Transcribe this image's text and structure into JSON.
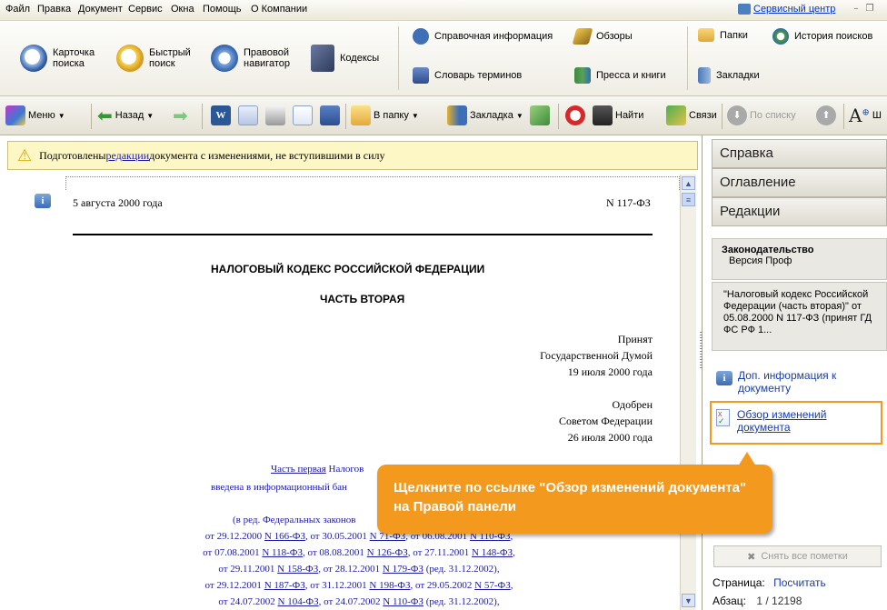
{
  "menu": {
    "items": [
      "Файл",
      "Правка",
      "Документ",
      "Сервис",
      "Окна",
      "Помощь",
      "О Компании"
    ],
    "service_center": "Сервисный центр",
    "win_min": "–",
    "win_restore": "❐"
  },
  "ribbon": {
    "card_search": "Карточка поиска",
    "quick_search": "Быстрый поиск",
    "legal_nav": "Правовой навигатор",
    "codes": "Кодексы",
    "reference": "Справочная информация",
    "reviews": "Обзоры",
    "glossary": "Словарь терминов",
    "press": "Пресса и книги",
    "folders": "Папки",
    "search_history": "История поисков",
    "bookmarks": "Закладки"
  },
  "toolbar": {
    "menu": "Меню",
    "back": "Назад",
    "to_folder": "В папку",
    "bookmark": "Закладка",
    "find": "Найти",
    "links": "Связи",
    "by_list": "По списку",
    "font_label": "Ш"
  },
  "notice": {
    "prefix": "Подготовлены ",
    "link": "редакции",
    "suffix": " документа с изменениями, не вступившими в силу"
  },
  "document": {
    "date": "5 августа 2000 года",
    "number": "N 117-ФЗ",
    "title": "НАЛОГОВЫЙ КОДЕКС РОССИЙСКОЙ ФЕДЕРАЦИИ",
    "part": "ЧАСТЬ ВТОРАЯ",
    "adopted": [
      "Принят",
      "Государственной Думой",
      "19 июля 2000 года"
    ],
    "approved": [
      "Одобрен",
      "Советом Федерации",
      "26 июля 2000 года"
    ],
    "intro_link": "Часть первая",
    "intro_text": " Налогов",
    "intro_line2": "введена в информационный бан",
    "editions_prefix": "(в ред. Федеральных законов ",
    "editions_line1": {
      "a": "от 29.12.2000 ",
      "l1": "N 166-ФЗ",
      "b": ", от 30.05.2001 ",
      "l2": "N 71-ФЗ",
      "c": ", от 06.08.2001 ",
      "l3": "N 110-ФЗ",
      "d": ","
    },
    "editions_line2": {
      "a": "от 07.08.2001 ",
      "l1": "N 118-ФЗ",
      "b": ", от 08.08.2001 ",
      "l2": "N 126-ФЗ",
      "c": ", от 27.11.2001 ",
      "l3": "N 148-ФЗ",
      "d": ","
    },
    "editions_line3": {
      "a": "от 29.11.2001 ",
      "l1": "N 158-ФЗ",
      "b": ", от 28.12.2001 ",
      "l2": "N 179-ФЗ",
      "c": " (ред. 31.12.2002),"
    },
    "editions_line4": {
      "a": "от 29.12.2001 ",
      "l1": "N 187-ФЗ",
      "b": ", от 31.12.2001 ",
      "l2": "N 198-ФЗ",
      "c": ", от 29.05.2002 ",
      "l3": "N 57-ФЗ",
      "d": ","
    },
    "editions_line5": {
      "a": "от 24.07.2002 ",
      "l1": "N 104-ФЗ",
      "b": ", от 24.07.2002 ",
      "l2": "N 110-ФЗ",
      "c": " (ред. 31.12.2002),"
    }
  },
  "right_panel": {
    "tabs": [
      "Справка",
      "Оглавление",
      "Редакции"
    ],
    "legislation_title": "Законодательство",
    "legislation_version": "Версия Проф",
    "doc_desc": "\"Налоговый кодекс Российской Федерации (часть вторая)\" от 05.08.2000 N 117-ФЗ (принят ГД ФС РФ 1...",
    "extra_info": "Доп. информация к документу",
    "changes_review": "Обзор изменений документа",
    "clear_marks": "Снять все пометки",
    "page_label": "Страница:",
    "page_value": "Посчитать",
    "para_label": "Абзац:",
    "para_value": "1 / 12198"
  },
  "callout": {
    "text": "Щелкните по ссылке \"Обзор изменений документа\" на Правой панели"
  },
  "colors": {
    "callout": "#f39a1e",
    "highlight_border": "#f39a1e",
    "link": "#1a1aa6",
    "notice_bg": "#fdf6c5"
  }
}
